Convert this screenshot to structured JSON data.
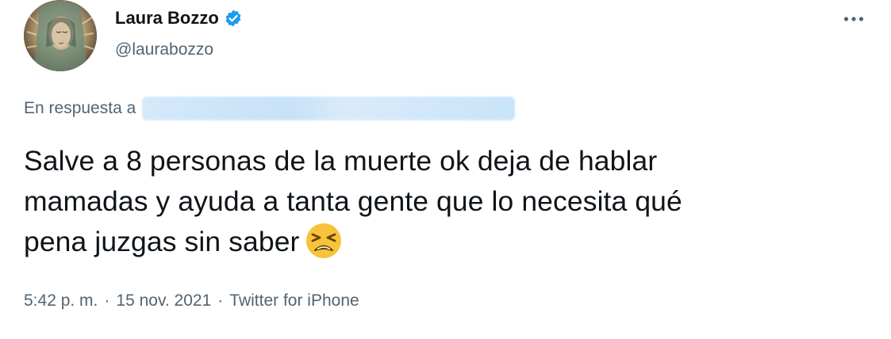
{
  "author": {
    "display_name": "Laura Bozzo",
    "handle": "@laurabozzo",
    "verified": true,
    "avatar": "virgin-of-guadalupe-avatar"
  },
  "reply": {
    "label": "En respuesta a",
    "target": "[redacted username]"
  },
  "tweet": {
    "lines": [
      "Salve a 8 personas de la muerte ok deja de hablar",
      "mamadas y ayuda a tanta gente que lo necesita qué",
      "pena juzgas sin saber"
    ],
    "emoji": "tired-face-emoji"
  },
  "meta": {
    "time": "5:42 p. m.",
    "separator": "·",
    "date": "15 nov. 2021",
    "source": "Twitter for iPhone"
  },
  "icons": {
    "more": "more-options-icon",
    "verified": "verified-badge-icon"
  },
  "colors": {
    "text": "#0f1419",
    "secondary": "#536471",
    "verified": "#1d9bf0",
    "redaction": "#c9e3f8",
    "emoji": "#f7c33c"
  }
}
